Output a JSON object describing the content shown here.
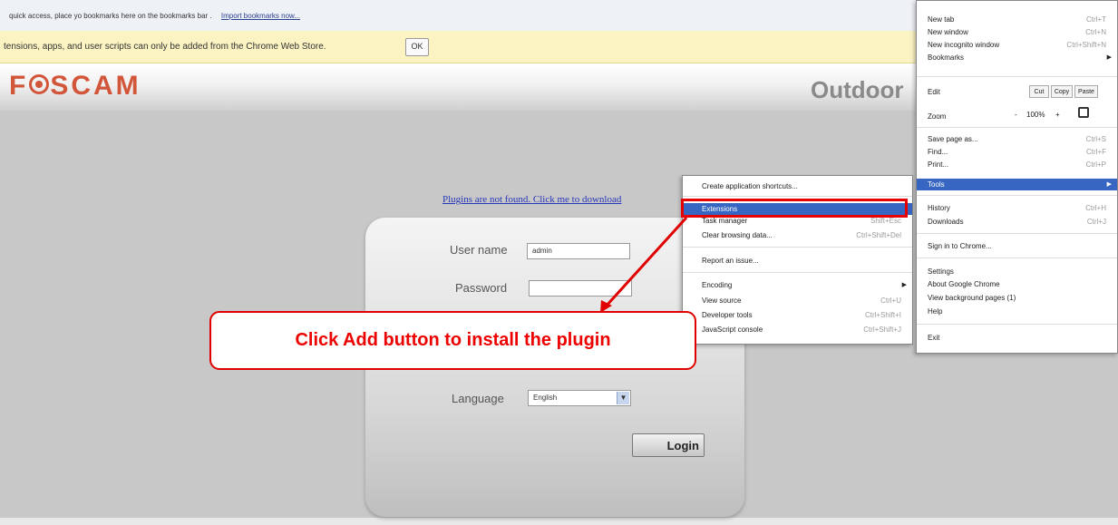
{
  "bookmarks_bar": {
    "text": "quick access, place yo bookmarks here on the bookmarks bar .",
    "import_link": "Import bookmarks now..."
  },
  "info_bar": {
    "message": "tensions, apps, and user scripts can only be added from the Chrome Web Store.",
    "ok_label": "OK"
  },
  "header": {
    "logo_pre": "F",
    "logo_post": "SCAM",
    "product": "Outdoor"
  },
  "page": {
    "plugin_link": "Plugins are not found. Click me to download"
  },
  "login": {
    "username_label": "User name",
    "username_value": "admin",
    "password_label": "Password",
    "language_label": "Language",
    "language_value": "English",
    "login_button": "Login"
  },
  "chrome_menu": {
    "new_tab": "New tab",
    "new_tab_sc": "Ctrl+T",
    "new_window": "New window",
    "new_window_sc": "Ctrl+N",
    "new_incognito": "New incognito window",
    "new_incognito_sc": "Ctrl+Shift+N",
    "bookmarks": "Bookmarks",
    "edit": "Edit",
    "cut": "Cut",
    "copy": "Copy",
    "paste": "Paste",
    "zoom": "Zoom",
    "zoom_minus": "-",
    "zoom_value": "100%",
    "zoom_plus": "+",
    "save_page": "Save page as...",
    "save_page_sc": "Ctrl+S",
    "find": "Find...",
    "find_sc": "Ctrl+F",
    "print": "Print...",
    "print_sc": "Ctrl+P",
    "tools": "Tools",
    "history": "History",
    "history_sc": "Ctrl+H",
    "downloads": "Downloads",
    "downloads_sc": "Ctrl+J",
    "sign_in": "Sign in to Chrome...",
    "settings": "Settings",
    "about": "About Google Chrome",
    "background_pages": "View background pages (1)",
    "help": "Help",
    "exit": "Exit"
  },
  "tools_menu": {
    "create_shortcuts": "Create application shortcuts...",
    "extensions": "Extensions",
    "task_manager": "Task manager",
    "task_manager_sc": "Shift+Esc",
    "clear_browsing": "Clear browsing data...",
    "clear_browsing_sc": "Ctrl+Shift+Del",
    "report_issue": "Report an issue...",
    "encoding": "Encoding",
    "view_source": "View source",
    "view_source_sc": "Ctrl+U",
    "dev_tools": "Developer tools",
    "dev_tools_sc": "Ctrl+Shift+I",
    "js_console": "JavaScript console",
    "js_console_sc": "Ctrl+Shift+J"
  },
  "callout": {
    "text": "Click Add button to install the plugin"
  },
  "colors": {
    "callout_red": "#e10000",
    "menu_highlight": "#3666c2",
    "logo": "#d2563a"
  }
}
